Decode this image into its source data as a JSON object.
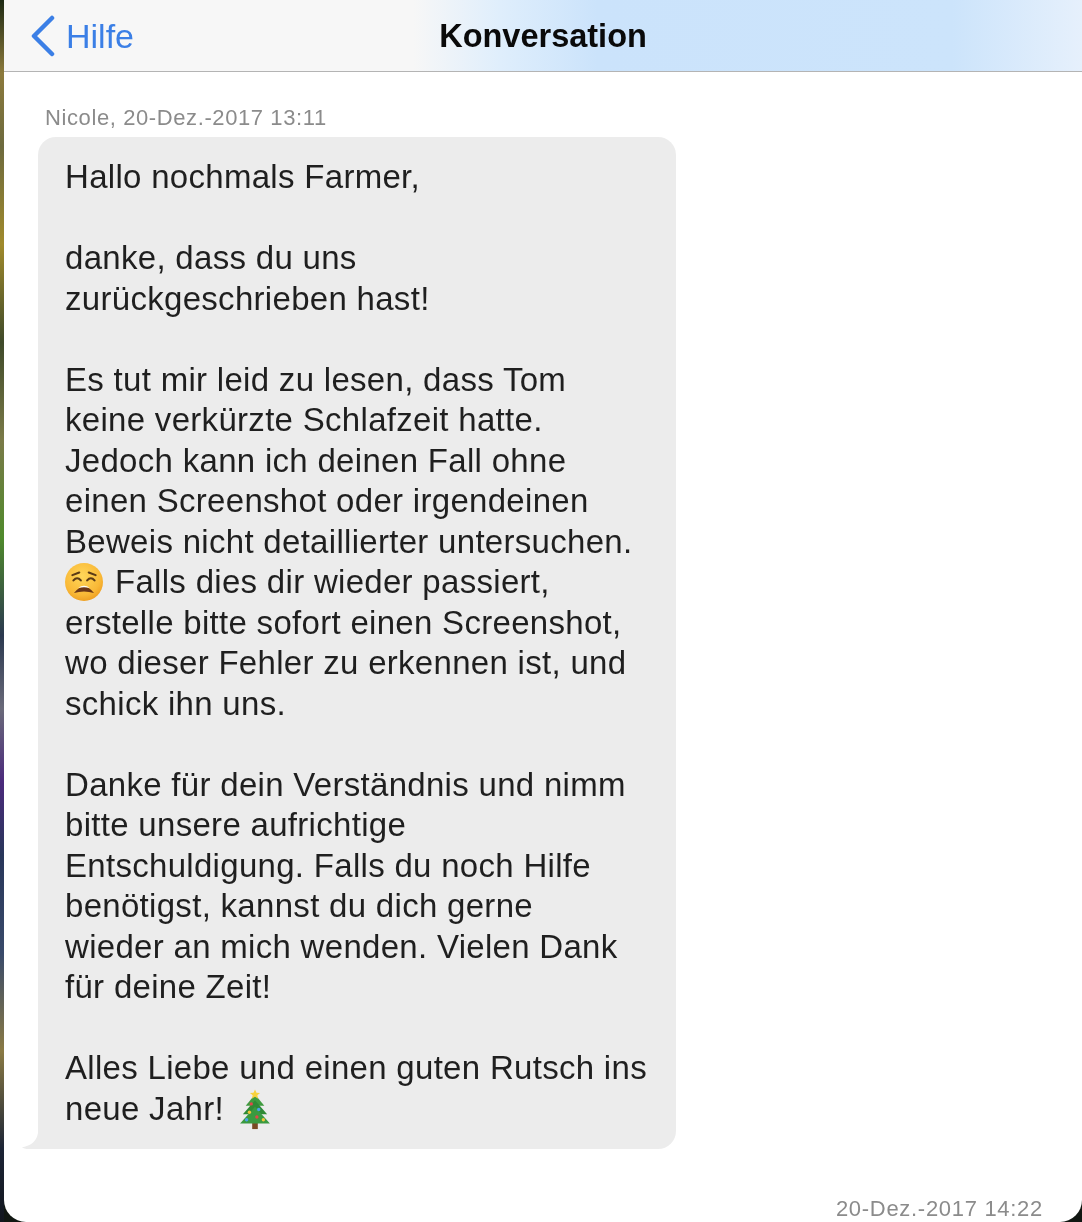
{
  "navigation_bar": {
    "back_label": "Hilfe",
    "title": "Konversation"
  },
  "message": {
    "sender_line": "Nicole, 20-Dez.-2017 13:11",
    "paragraphs": [
      [
        [
          {
            "kind": "text",
            "text": "Hallo nochmals Farmer,"
          }
        ]
      ],
      [
        [
          {
            "kind": "text",
            "text": "danke, dass du uns\nzurückgeschrieben hast!"
          }
        ]
      ],
      [
        [
          {
            "kind": "text",
            "text": "Es tut mir leid zu lesen, dass Tom\nkeine verkürzte Schlafzeit hatte.\nJedoch kann ich deinen Fall ohne\neinen Screenshot oder irgendeinen\nBeweis nicht detaillierter untersuchen."
          }
        ],
        [
          {
            "kind": "emoji"
          },
          {
            "kind": "text",
            "text": "Falls dies dir wieder passiert,"
          }
        ],
        [
          {
            "kind": "text",
            "text": "erstelle bitte sofort einen Screenshot,\nwo dieser Fehler zu erkennen ist, und\nschick ihn uns."
          }
        ]
      ],
      [
        [
          {
            "kind": "text",
            "text": "Danke für dein Verständnis und nimm\nbitte unsere aufrichtige\nEntschuldigung. Falls du noch Hilfe\nbenötigst, kannst du dich gerne\nwieder an mich wenden. Vielen Dank\nfür deine Zeit!"
          }
        ]
      ],
      [
        [
          {
            "kind": "text",
            "text": "Alles Liebe und einen guten Rutsch ins"
          }
        ],
        [
          {
            "kind": "text",
            "text": "neue Jahr!"
          },
          {
            "kind": "emoji"
          }
        ]
      ]
    ]
  },
  "footer_timestamp": "20-Dez.-2017 14:22"
}
